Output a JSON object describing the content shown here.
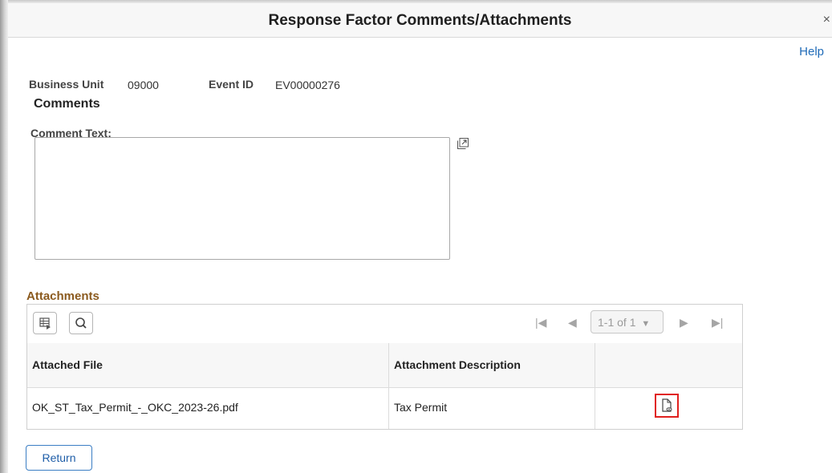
{
  "header": {
    "title": "Response Factor Comments/Attachments",
    "close_label": "×"
  },
  "help_link": "Help",
  "business_unit": {
    "label": "Business Unit",
    "value": "09000"
  },
  "event_id": {
    "label": "Event ID",
    "value": "EV00000276"
  },
  "comments": {
    "section_title": "Comments",
    "comment_text_label": "Comment Text:",
    "comment_text_value": ""
  },
  "attachments": {
    "section_title": "Attachments",
    "pager": {
      "first_icon": "first-page-icon",
      "prev_icon": "prev-page-icon",
      "range": "1-1 of 1",
      "next_icon": "next-page-icon",
      "last_icon": "last-page-icon"
    },
    "columns": [
      "Attached File",
      "Attachment Description",
      ""
    ],
    "rows": [
      {
        "file": "OK_ST_Tax_Permit_-_OKC_2023-26.pdf",
        "description": "Tax Permit",
        "action_icon": "view-attachment-icon"
      }
    ]
  },
  "return_label": "Return",
  "colors": {
    "section_accent": "#8b5a1e",
    "link": "#1f6bb8",
    "highlight": "#e0201e"
  }
}
